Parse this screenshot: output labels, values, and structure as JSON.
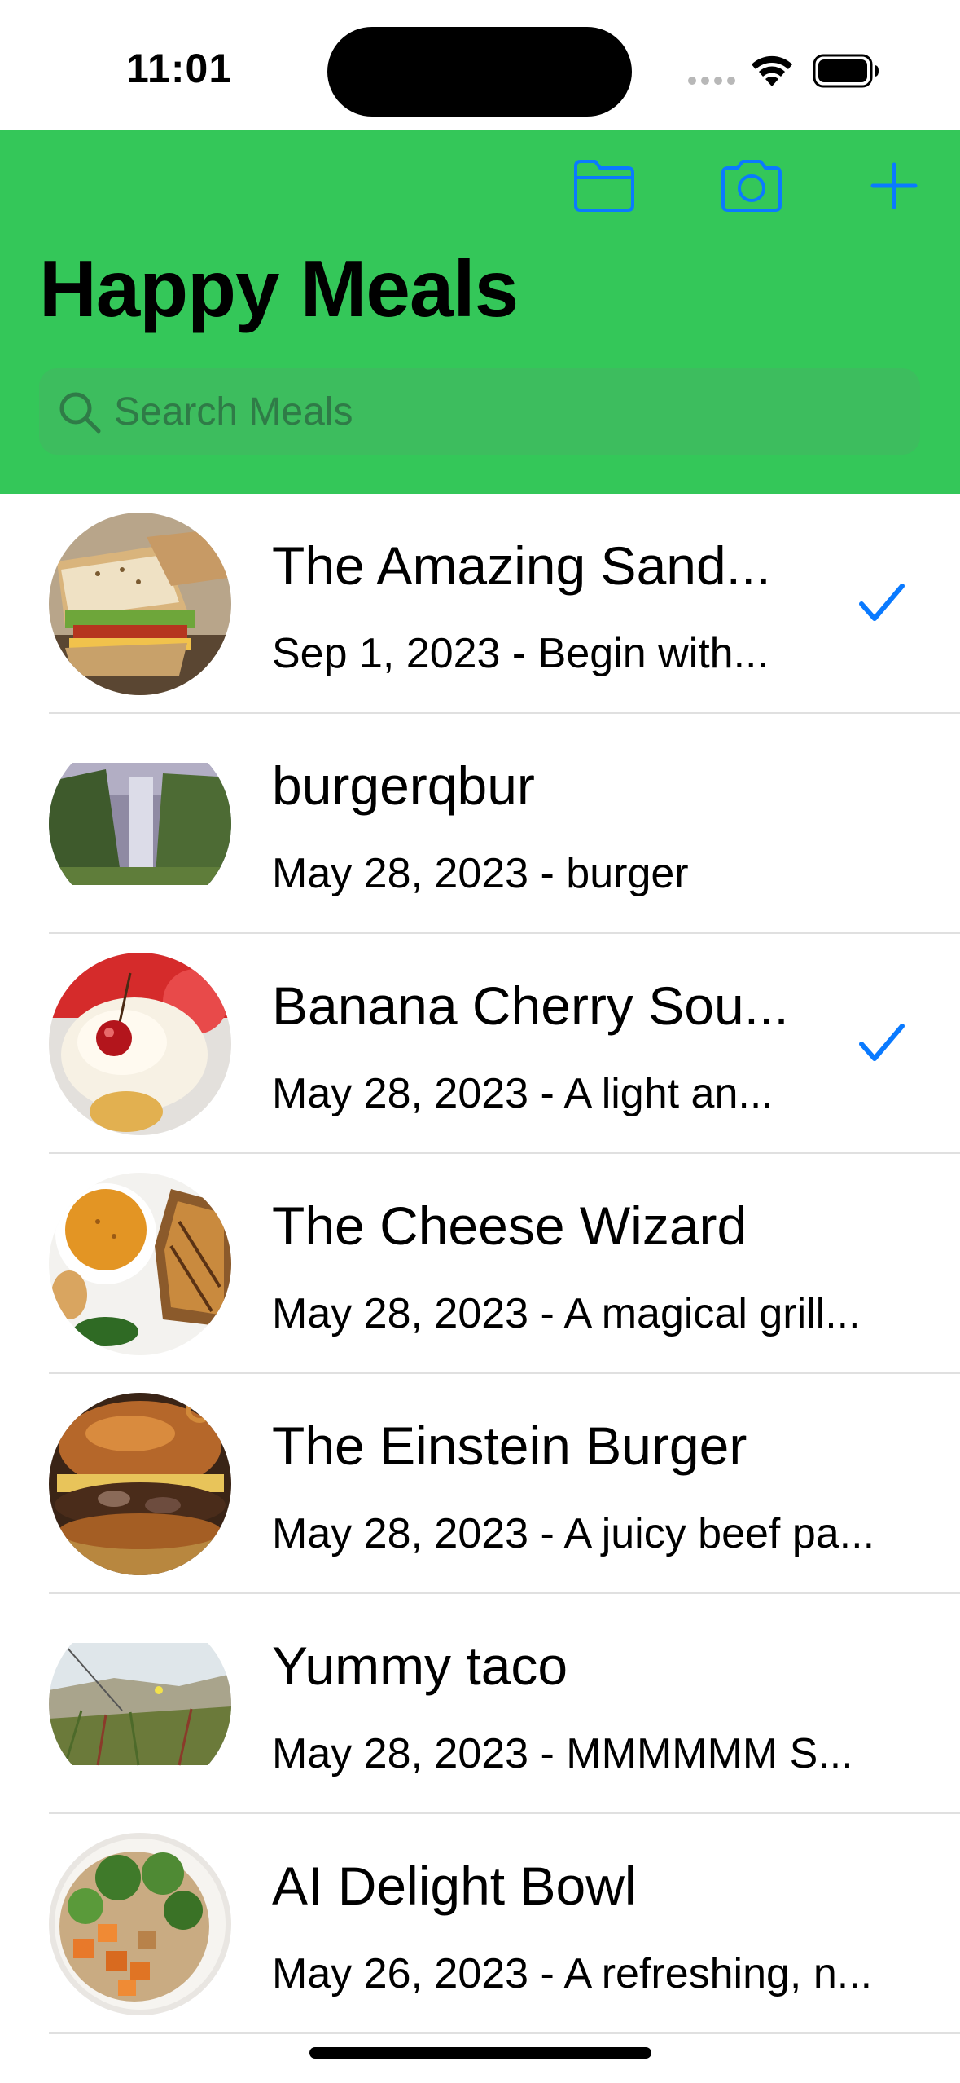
{
  "status_bar": {
    "time": "11:01"
  },
  "header": {
    "title": "Happy Meals",
    "toolbar": {
      "folder_icon": "folder-icon",
      "camera_icon": "camera-icon",
      "add_icon": "plus-icon"
    },
    "search": {
      "placeholder": "Search Meals",
      "icon": "search-icon"
    }
  },
  "colors": {
    "header_bg": "#34c759",
    "accent": "#0a7aff",
    "search_bg": "#3dbd5e"
  },
  "meals": [
    {
      "title": "The Amazing Sand...",
      "subtitle": "Sep 1, 2023 - Begin with...",
      "checked": true,
      "thumb": "sandwich"
    },
    {
      "title": "burgerqbur",
      "subtitle": "May 28, 2023 - burger",
      "checked": false,
      "thumb": "waterfall"
    },
    {
      "title": "Banana Cherry Sou...",
      "subtitle": "May 28, 2023 - A light an...",
      "checked": true,
      "thumb": "sundae"
    },
    {
      "title": "The Cheese Wizard",
      "subtitle": "May 28, 2023 - A magical grill...",
      "checked": false,
      "thumb": "grilled-cheese"
    },
    {
      "title": "The Einstein Burger",
      "subtitle": "May 28, 2023 - A juicy beef pa...",
      "checked": false,
      "thumb": "burger"
    },
    {
      "title": "Yummy taco",
      "subtitle": "May 28, 2023 - MMMMMM S...",
      "checked": false,
      "thumb": "dunes"
    },
    {
      "title": "AI Delight Bowl",
      "subtitle": "May 26, 2023 - A refreshing, n...",
      "checked": false,
      "thumb": "bowl"
    }
  ]
}
